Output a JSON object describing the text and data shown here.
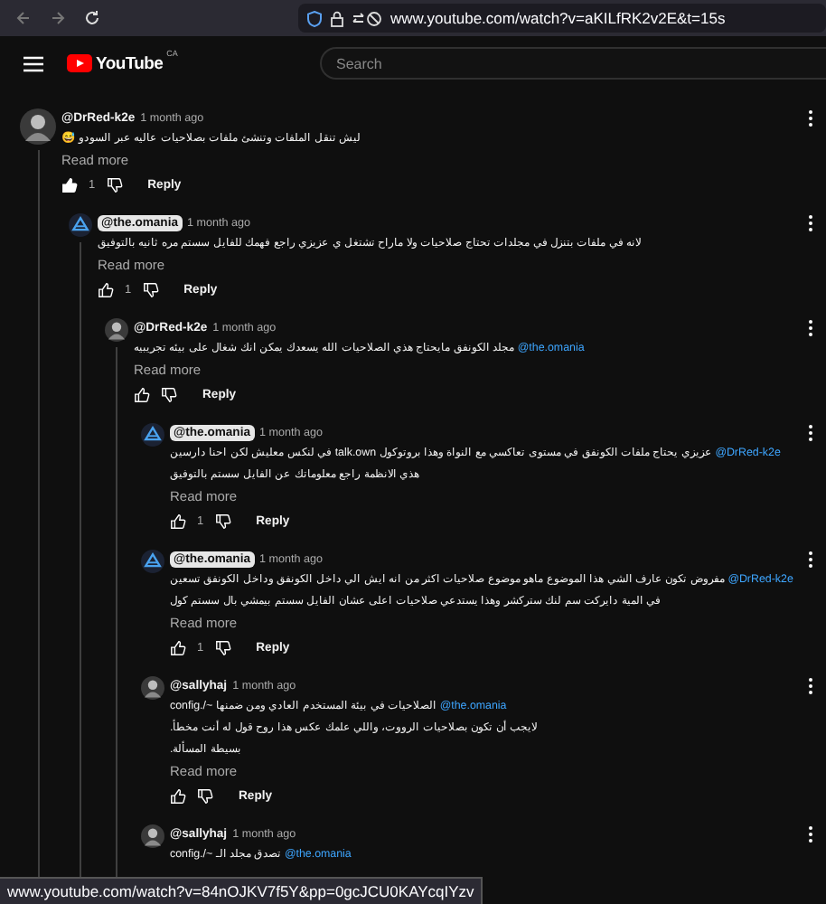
{
  "browser": {
    "url": "www.youtube.com/watch?v=aKILfRK2v2E&t=15s"
  },
  "header": {
    "logo": "YouTube",
    "region": "CA",
    "search": {
      "placeholder": "Search"
    }
  },
  "comments": [
    {
      "author": "@DrRed-k2e",
      "owner": false,
      "time": "1 month ago",
      "text": "ليش تنقل الملفات وتنشئ ملفات بصلاحيات عاليه عبر السودو 😅",
      "read_more": "Read more",
      "likes": "1",
      "reply": "Reply",
      "children": [
        {
          "author": "@the.omania",
          "owner": true,
          "time": "1 month ago",
          "text": "لانه في ملفات بتنزل في مجلدات تحتاج صلاحيات ولا ماراح تشتغل ي عزيزي راجع فهمك للفايل سستم مره ثانيه بالتوفيق",
          "read_more": "Read more",
          "likes": "1",
          "reply": "Reply",
          "children": [
            {
              "author": "@DrRed-k2e",
              "owner": false,
              "time": "1 month ago",
              "mention": "@the.omania",
              "text": "مجلد الكونفق مايحتاج هذي الصلاحيات الله يسعدك يمكن انك شغال على بيئه تجريبيه",
              "read_more": "Read more",
              "reply": "Reply",
              "children": [
                {
                  "author": "@the.omania",
                  "owner": true,
                  "time": "1 month ago",
                  "mention": "@DrRed-k2e",
                  "text": "عزيزي يحتاج ملفات الكونفق في مستوى تعاكسي مع النواة وهذا بروتوكول talk.own في لنكس معليش لكن احنا دارسين هذي الانظمة راجع معلوماتك عن الفايل سستم بالتوفيق",
                  "read_more": "Read more",
                  "likes": "1",
                  "reply": "Reply"
                },
                {
                  "author": "@the.omania",
                  "owner": true,
                  "time": "1 month ago",
                  "mention": "@DrRed-k2e",
                  "text": "مفروض تكون عارف الشي هذا الموضوع ماهو موضوع صلاحيات اكثر من انه ايش الي داخل الكونفق وداخل الكونفق تسعين في المية دايركت سم لنك ستركشر وهذا يستدعي صلاحيات اعلى عشان الفايل سستم بيمشي بال سستم كول",
                  "read_more": "Read more",
                  "likes": "1",
                  "reply": "Reply"
                },
                {
                  "author": "@sallyhaj",
                  "owner": false,
                  "time": "1 month ago",
                  "mention": "@the.omania",
                  "text": "الصلاحيات في بيئة المستخدم العادي ومن ضمنها ~/.config\nلايجب أن تكون بصلاحيات الرووت، واللي علمك عكس هذا روح قول له أنت مخطأ.\nبسيطة المسألة.",
                  "read_more": "Read more",
                  "reply": "Reply"
                },
                {
                  "author": "@sallyhaj",
                  "owner": false,
                  "time": "1 month ago",
                  "mention": "@the.omania",
                  "text": "تصدق مجلد الـ ~/.config"
                }
              ]
            }
          ]
        }
      ]
    }
  ],
  "status_bar": {
    "url": "www.youtube.com/watch?v=84nOJKV7f5Y&pp=0gcJCU0KAYcqIYzv"
  }
}
